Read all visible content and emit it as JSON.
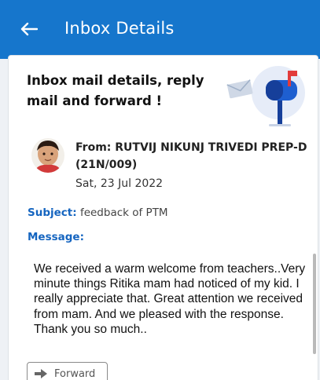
{
  "appbar": {
    "title": "Inbox Details",
    "back_icon": "arrow-left-icon",
    "bg_color": "#1676cc"
  },
  "header": {
    "text": "Inbox mail details, reply mail and forward !",
    "illustration": "mailbox-illustration"
  },
  "sender": {
    "from_text": "From: RUTVIJ NIKUNJ TRIVEDI PREP-D (21N/009)",
    "date": "Sat, 23 Jul 2022"
  },
  "subject": {
    "label": "Subject:",
    "value": "feedback of PTM"
  },
  "message": {
    "label": "Message:",
    "body": "We received a warm welcome from teachers..Very minute things Ritika mam had noticed of my kid. I really appreciate that. Great attention we received from mam. And we pleased with the response. Thank you so much.."
  },
  "actions": {
    "forward_label": "Forward",
    "forward_icon": "arrow-right-icon"
  },
  "colors": {
    "accent": "#1565c0",
    "mailbox_blue": "#1e5fd0",
    "mailbox_flag": "#e23b3b"
  }
}
